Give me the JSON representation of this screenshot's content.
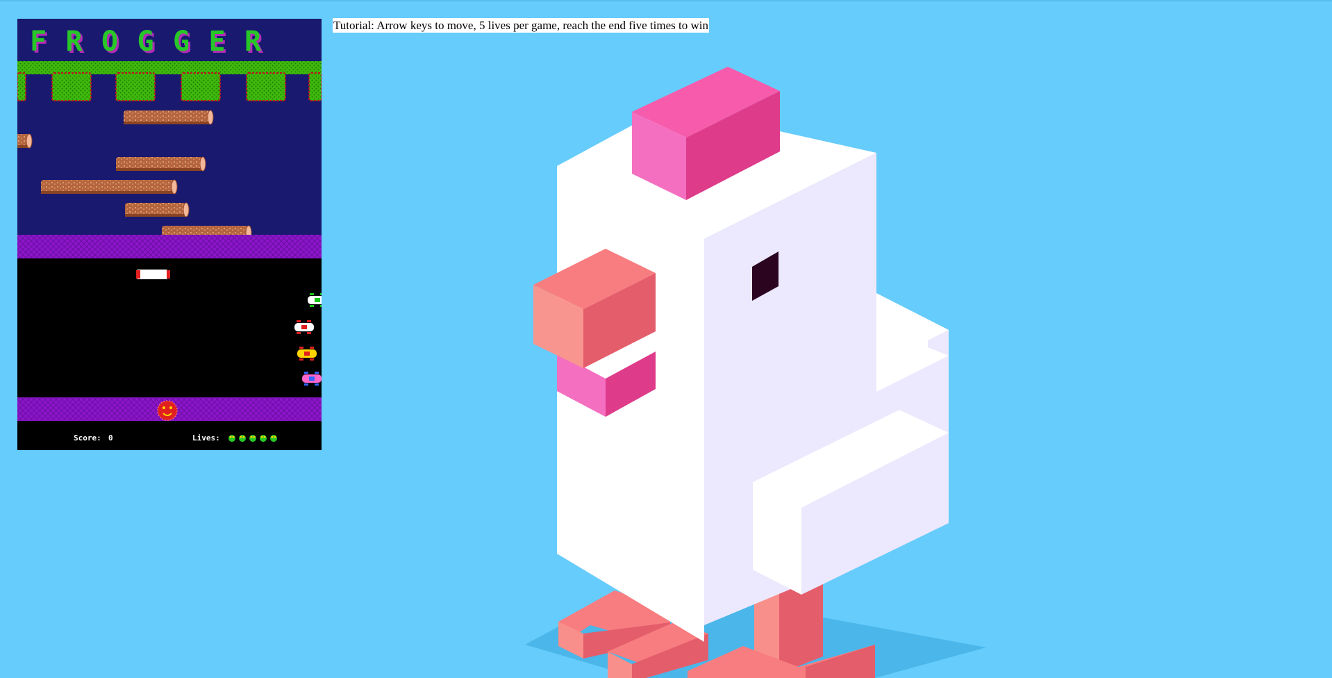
{
  "game": {
    "title": "FROGGER",
    "score_label": "Score:",
    "score": "0",
    "lives_label": "Lives:",
    "lives": 5,
    "colors": {
      "water": "#191970",
      "goal_grass": "#3fb90c",
      "goal_border": "#c1121f",
      "median": "#8c15c9",
      "road": "#000000",
      "log": "#b5653e",
      "title_green": "#27c727",
      "title_shadow": "#b12bb5"
    },
    "icons": {
      "frog": "frog-icon",
      "lives": "frog-life-icon",
      "car": "car-icon",
      "truck": "truck-icon",
      "log": "log-icon"
    }
  },
  "tutorial": {
    "text": "Tutorial: Arrow keys to move, 5 lives per game, reach the end five times to win"
  },
  "background": {
    "color": "#66ccfb",
    "mascot": "chicken-illustration"
  }
}
